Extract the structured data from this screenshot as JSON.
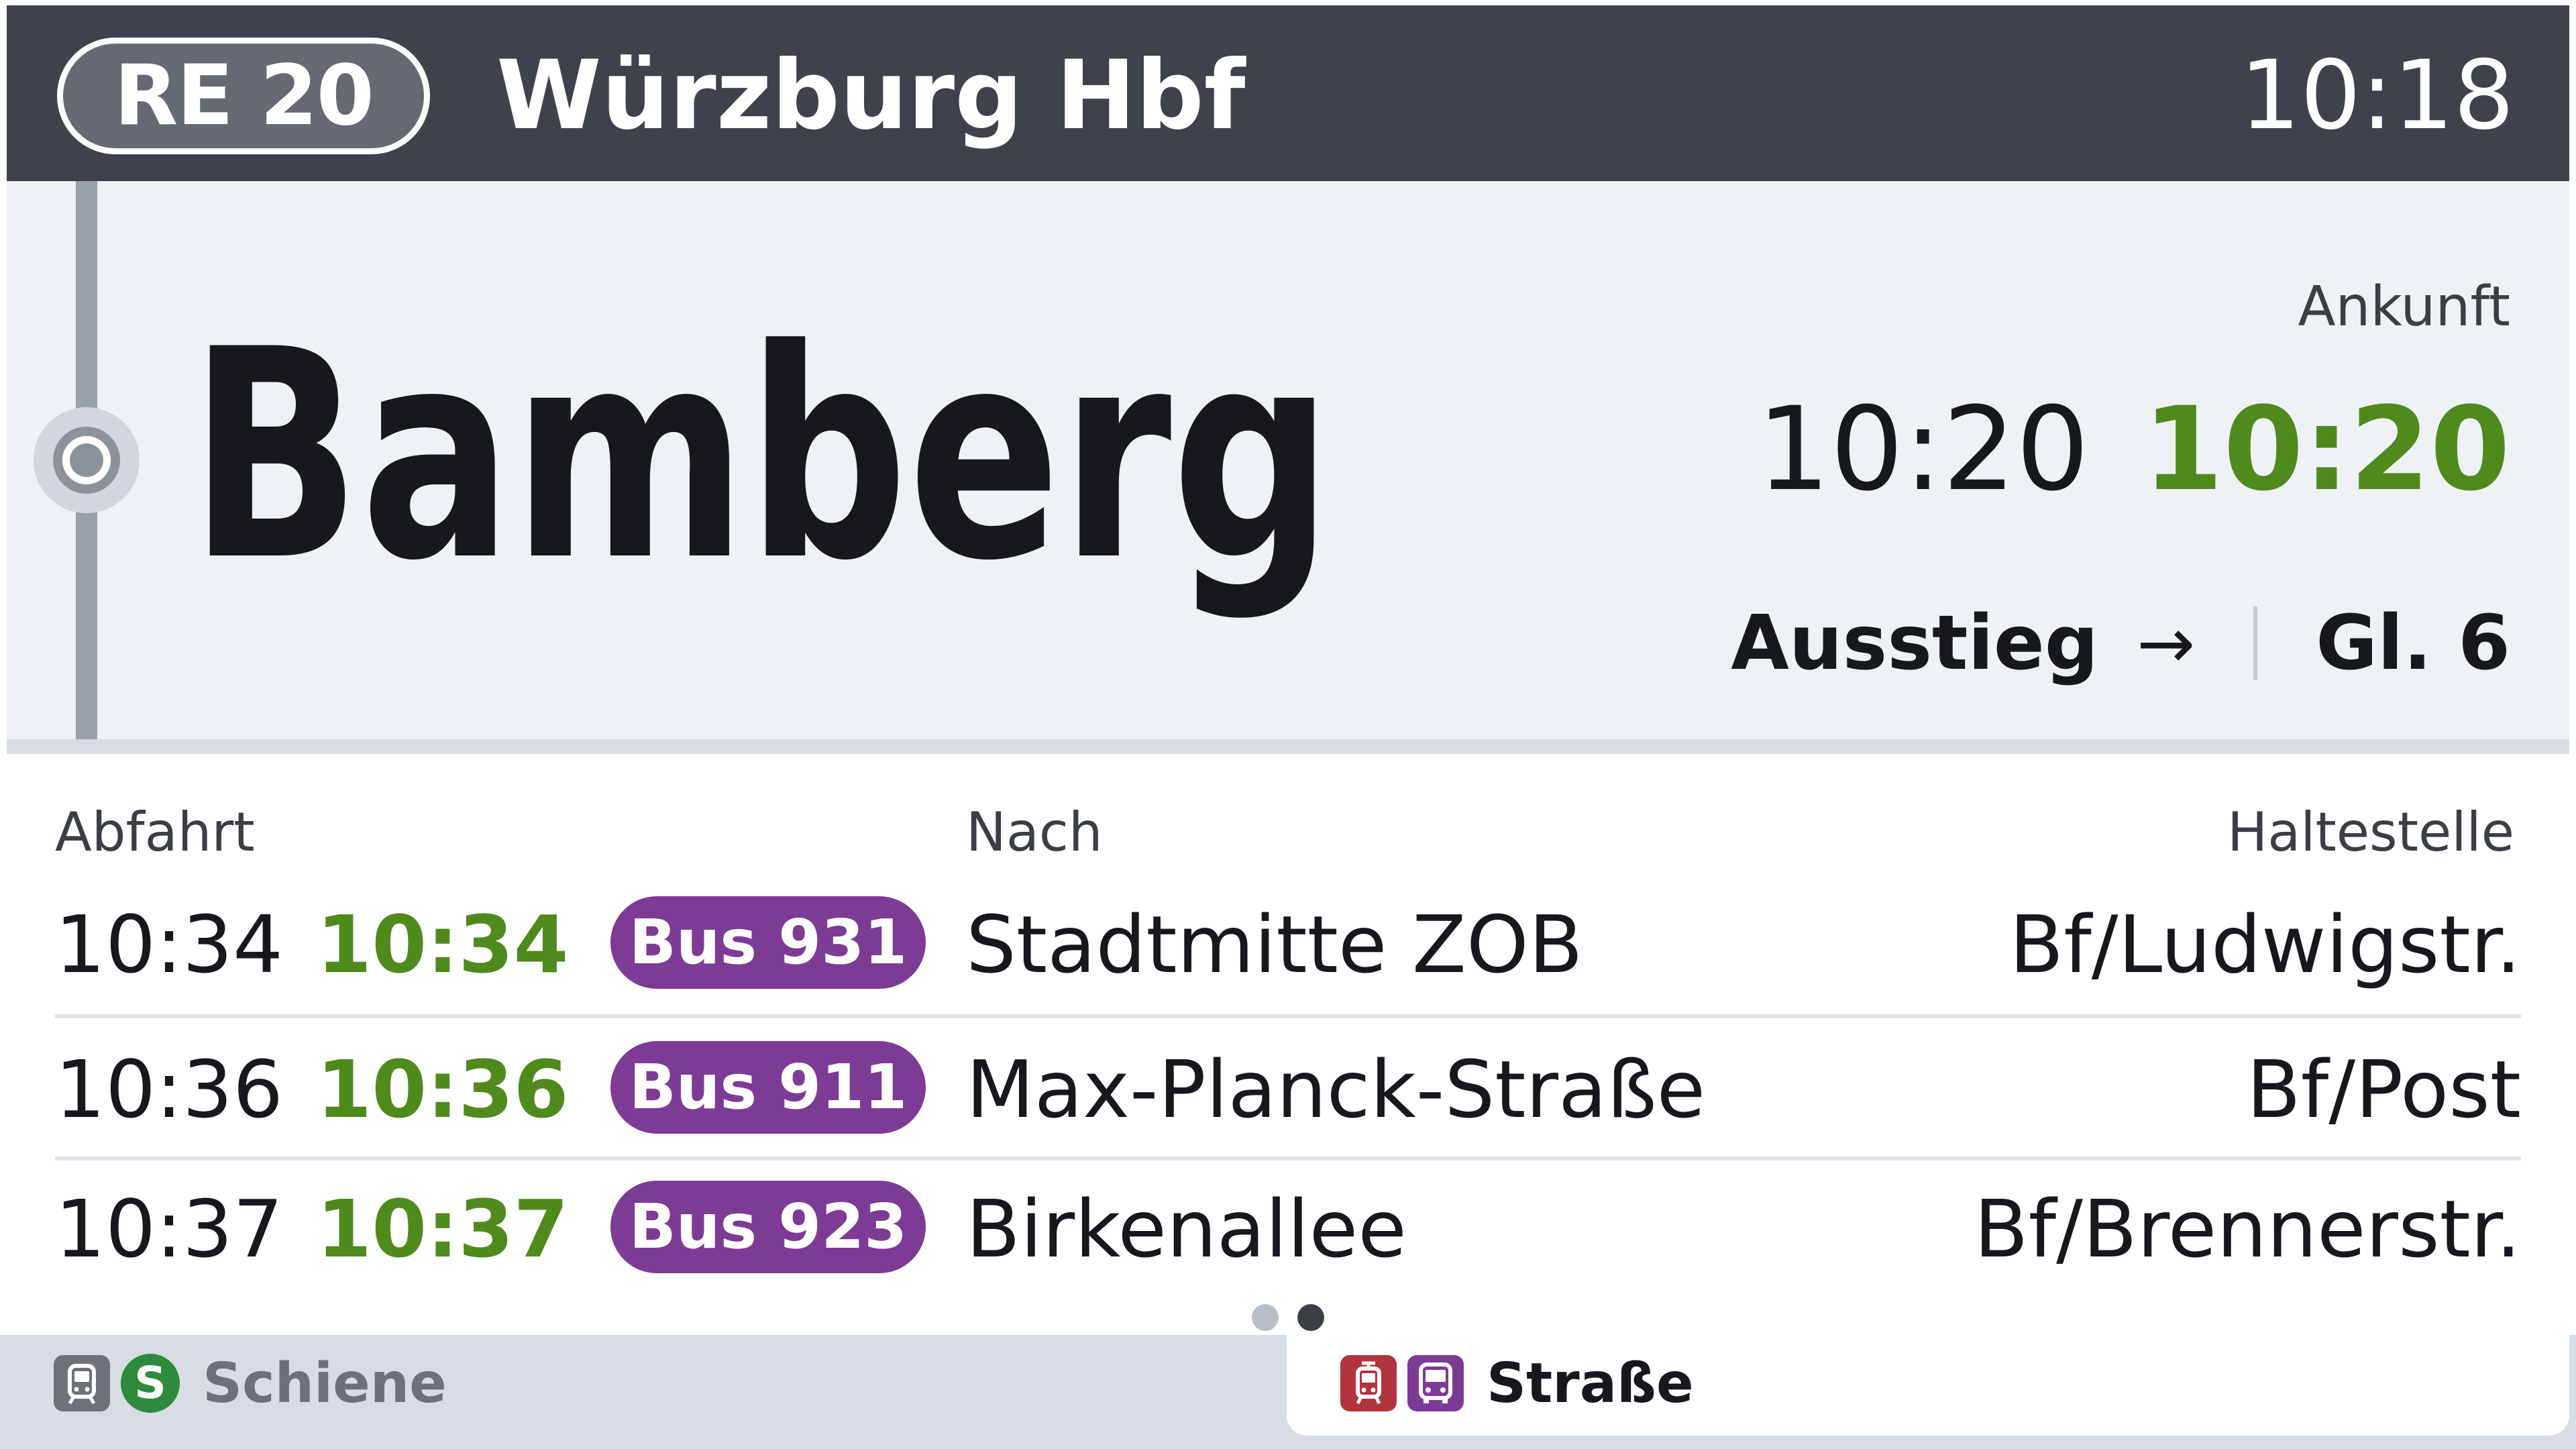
{
  "header": {
    "line": "RE 20",
    "destination": "Würzburg Hbf",
    "current_time": "10:18"
  },
  "next_stop": {
    "name": "Bamberg",
    "arrival_label": "Ankunft",
    "arrival_planned": "10:20",
    "arrival_actual": "10:20",
    "exit_label": "Ausstieg",
    "exit_arrow": "→",
    "platform": "Gl. 6"
  },
  "departures": {
    "columns": {
      "departure": "Abfahrt",
      "destination": "Nach",
      "stop": "Haltestelle"
    },
    "rows": [
      {
        "planned": "10:34",
        "actual": "10:34",
        "line": "Bus 931",
        "destination": "Stadtmitte ZOB",
        "stop": "Bf/Ludwigstr."
      },
      {
        "planned": "10:36",
        "actual": "10:36",
        "line": "Bus 911",
        "destination": "Max-Planck-Straße",
        "stop": "Bf/Post"
      },
      {
        "planned": "10:37",
        "actual": "10:37",
        "line": "Bus 923",
        "destination": "Birkenallee",
        "stop": "Bf/Brennerstr."
      }
    ],
    "pager": {
      "pages": 2,
      "current": 2
    }
  },
  "tabs": {
    "rail": {
      "label": "Schiene",
      "icons": [
        "train-icon",
        "s-bahn-icon"
      ],
      "s_bahn_glyph": "S"
    },
    "road": {
      "label": "Straße",
      "icons": [
        "tram-icon",
        "bus-icon"
      ]
    }
  },
  "colors": {
    "header_bg": "#3e424c",
    "panel_bg": "#eef2f5",
    "on_time_green": "#4f8a1d",
    "bus_purple": "#7d3b95",
    "tram_red": "#b2343f",
    "s_bahn_green": "#2e8b3e"
  }
}
